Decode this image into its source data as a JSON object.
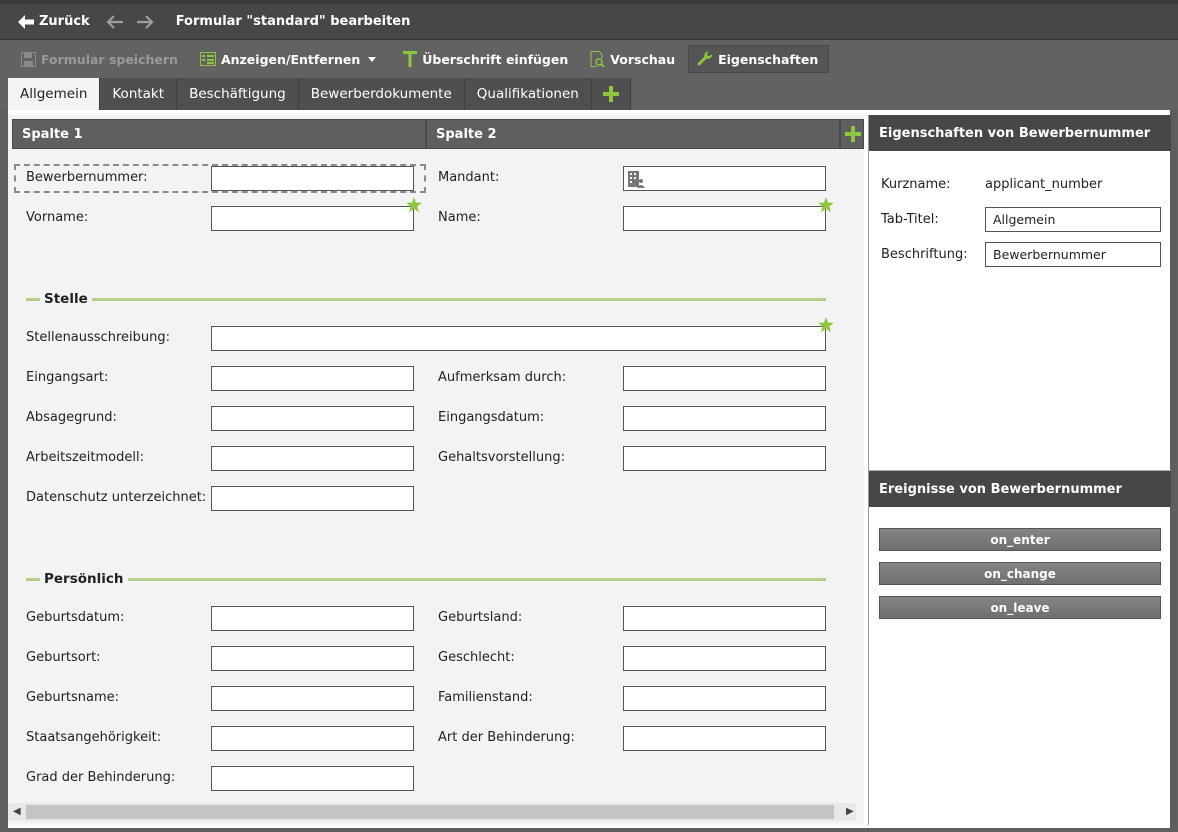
{
  "titlebar": {
    "back_label": "Zurück",
    "title": "Formular \"standard\" bearbeiten"
  },
  "toolbar": {
    "save": "Formular speichern",
    "show_hide": "Anzeigen/Entfernen",
    "insert_heading": "Überschrift einfügen",
    "preview": "Vorschau",
    "properties": "Eigenschaften"
  },
  "tabs": [
    "Allgemein",
    "Kontakt",
    "Beschäftigung",
    "Bewerberdokumente",
    "Qualifikationen"
  ],
  "columns": [
    "Spalte 1",
    "Spalte 2"
  ],
  "form": {
    "fields": {
      "bewerbernummer": "Bewerbernummer:",
      "mandant": "Mandant:",
      "vorname": "Vorname:",
      "name": "Name:",
      "stellenausschreibung": "Stellenausschreibung:",
      "eingangsart": "Eingangsart:",
      "aufmerksam": "Aufmerksam durch:",
      "absagegrund": "Absagegrund:",
      "eingangsdatum": "Eingangsdatum:",
      "arbeitszeitmodell": "Arbeitszeitmodell:",
      "gehaltsvorstellung": "Gehaltsvorstellung:",
      "datenschutz": "Datenschutz unterzeichnet:",
      "geburtsdatum": "Geburtsdatum:",
      "geburtsland": "Geburtsland:",
      "geburtsort": "Geburtsort:",
      "geschlecht": "Geschlecht:",
      "geburtsname": "Geburtsname:",
      "familienstand": "Familienstand:",
      "staatsangehoerigkeit": "Staatsangehörigkeit:",
      "behinderung_art": "Art der Behinderung:",
      "behinderung_grad": "Grad der Behinderung:"
    },
    "sections": {
      "stelle": "Stelle",
      "persoenlich": "Persönlich"
    }
  },
  "properties_panel": {
    "title": "Eigenschaften von Bewerbernummer",
    "kurzname_label": "Kurzname:",
    "kurzname_value": "applicant_number",
    "tab_titel_label": "Tab-Titel:",
    "tab_titel_value": "Allgemein",
    "beschriftung_label": "Beschriftung:",
    "beschriftung_value": "Bewerbernummer"
  },
  "events_panel": {
    "title": "Ereignisse von Bewerbernummer",
    "events": [
      "on_enter",
      "on_change",
      "on_leave"
    ]
  },
  "colors": {
    "accent_green": "#8dc63f",
    "section_line": "#b2cf8c",
    "dark_header": "#474747"
  }
}
